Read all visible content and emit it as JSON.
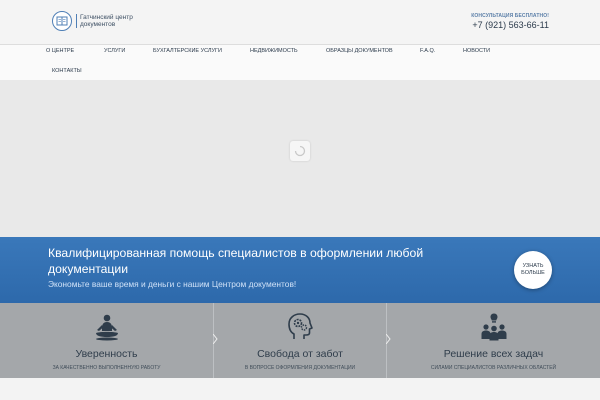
{
  "header": {
    "logo_text": "Гатчинский центр документов",
    "consult": "КОНСУЛЬТАЦИЯ БЕСПЛАТНО!",
    "phone": "+7 (921) 563-66-11"
  },
  "nav": {
    "items": [
      "О ЦЕНТРЕ",
      "УСЛУГИ",
      "БУХГАЛТЕРСКИЕ УСЛУГИ",
      "НЕДВИЖИМОСТЬ",
      "ОБРАЗЦЫ ДОКУМЕНТОВ",
      "F.A.Q.",
      "НОВОСТИ",
      "КОНТАКТЫ"
    ]
  },
  "banner": {
    "title": "Квалифицированная помощь специалистов в оформлении любой документации",
    "subtitle": "Экономьте ваше время и деньги с нашим Центром документов!",
    "more_button": "УЗНАТЬ БОЛЬШЕ"
  },
  "features": [
    {
      "icon": "meditation-icon",
      "title": "Уверенность",
      "subtitle": "ЗА КАЧЕСТВЕННО ВЫПОЛНЕННУЮ РАБОТУ"
    },
    {
      "icon": "head-gears-icon",
      "title": "Свобода от забот",
      "subtitle": "В ВОПРОСЕ ОФОРМЛЕНИЯ ДОКУМЕНТАЦИИ"
    },
    {
      "icon": "team-icon",
      "title": "Решение всех задач",
      "subtitle": "СИЛАМИ СПЕЦИАЛИСТОВ РАЗЛИЧНЫХ ОБЛАСТЕЙ"
    }
  ],
  "colors": {
    "accent": "#3273b5",
    "feature_bg": "#a4a7aa",
    "text_dark": "#2b3a4b"
  }
}
